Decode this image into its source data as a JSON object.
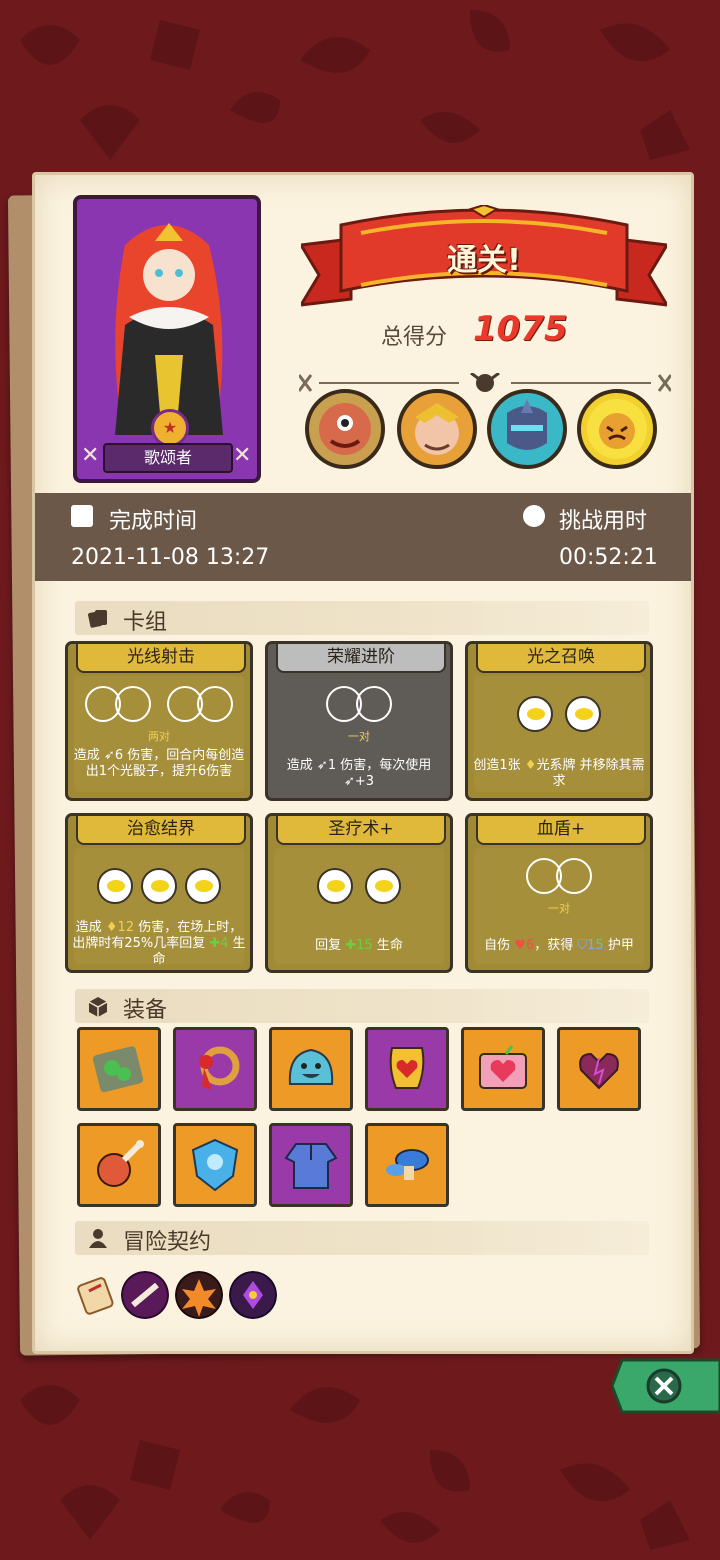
{
  "result": {
    "banner": "通关!",
    "score_label": "总得分",
    "score_value": "1075"
  },
  "hero": {
    "name": "歌颂者"
  },
  "stats": {
    "finish_time_label": "完成时间",
    "finish_time_value": "2021-11-08 13:27",
    "challenge_time_label": "挑战用时",
    "challenge_time_value": "00:52:21"
  },
  "deck": {
    "title": "卡组",
    "cards": [
      {
        "name": "光线射击",
        "dice_tag": "两对",
        "desc_a": "造成 ",
        "desc_b": "6",
        "desc_c": " 伤害，回合内每创造出1个光骰子，提升6伤害"
      },
      {
        "name": "荣耀进阶",
        "dice_tag": "一对",
        "desc_a": "造成 ",
        "desc_b": "1",
        "desc_c": " 伤害，每次使用 ",
        "desc_d": "+3"
      },
      {
        "name": "光之召唤",
        "dice_tag": "",
        "desc_a": "创造1张 ",
        "desc_b": "光系牌",
        "desc_c": " 并移除其需求"
      },
      {
        "name": "治愈结界",
        "dice_tag": "",
        "desc_a": "造成 ",
        "desc_b": "12",
        "desc_c": " 伤害，在场上时，出牌时有25%几率回复 ",
        "desc_d": "4",
        "desc_e": " 生命"
      },
      {
        "name": "圣疗术+",
        "dice_tag": "",
        "desc_a": "回复 ",
        "desc_b": "15",
        "desc_c": " 生命"
      },
      {
        "name": "血盾+",
        "dice_tag": "一对",
        "desc_a": "自伤 ",
        "desc_b": "6",
        "desc_c": "，获得 ",
        "desc_d": "15",
        "desc_e": " 护甲"
      }
    ]
  },
  "equipment": {
    "title": "装备",
    "items": [
      {
        "icon": "moss-tablet-icon",
        "frame": "orange"
      },
      {
        "icon": "blood-ring-icon",
        "frame": "purple"
      },
      {
        "icon": "blue-slime-icon",
        "frame": "orange"
      },
      {
        "icon": "heart-shield-icon",
        "frame": "purple"
      },
      {
        "icon": "heart-box-icon",
        "frame": "orange"
      },
      {
        "icon": "cursed-heart-icon",
        "frame": "orange"
      },
      {
        "icon": "meat-leg-icon",
        "frame": "orange"
      },
      {
        "icon": "ice-shield-icon",
        "frame": "orange"
      },
      {
        "icon": "blue-tunic-icon",
        "frame": "purple"
      },
      {
        "icon": "mushroom-icon",
        "frame": "orange"
      }
    ]
  },
  "contract": {
    "title": "冒险契约",
    "items": [
      "scroll-icon",
      "bone-icon",
      "flame-burst-icon",
      "purple-crystal-icon"
    ]
  },
  "colors": {
    "background": "#6e1a1d",
    "score_red": "#e8392a",
    "card_gold": "#e0b83a",
    "card_grey": "#bdbdbd",
    "frame_orange": "#ee9a26",
    "frame_purple": "#9a3aa8",
    "close_green": "#3aa86a"
  }
}
